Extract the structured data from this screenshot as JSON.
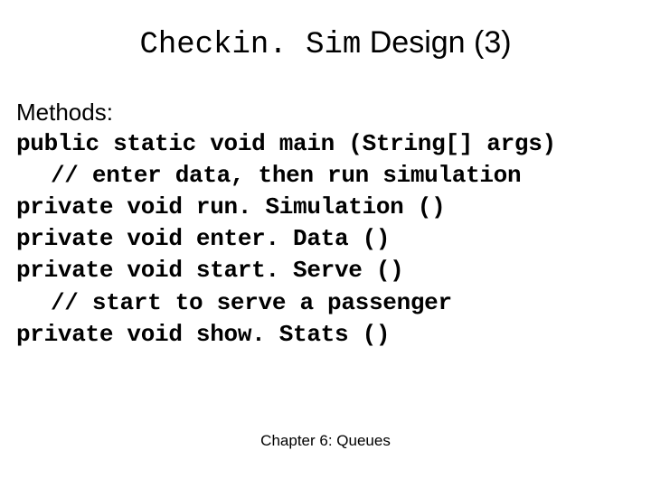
{
  "title": {
    "mono": "Checkin. Sim",
    "rest": " Design (3)"
  },
  "body": {
    "methods_label": "Methods:",
    "line1": "public static void main (String[] args)",
    "line2": "// enter data, then run simulation",
    "line3": "private void run. Simulation ()",
    "line4": "private void enter. Data ()",
    "line5": "private void start. Serve ()",
    "line6": "// start to serve a passenger",
    "line7": "private void show. Stats ()"
  },
  "footer": "Chapter 6: Queues"
}
